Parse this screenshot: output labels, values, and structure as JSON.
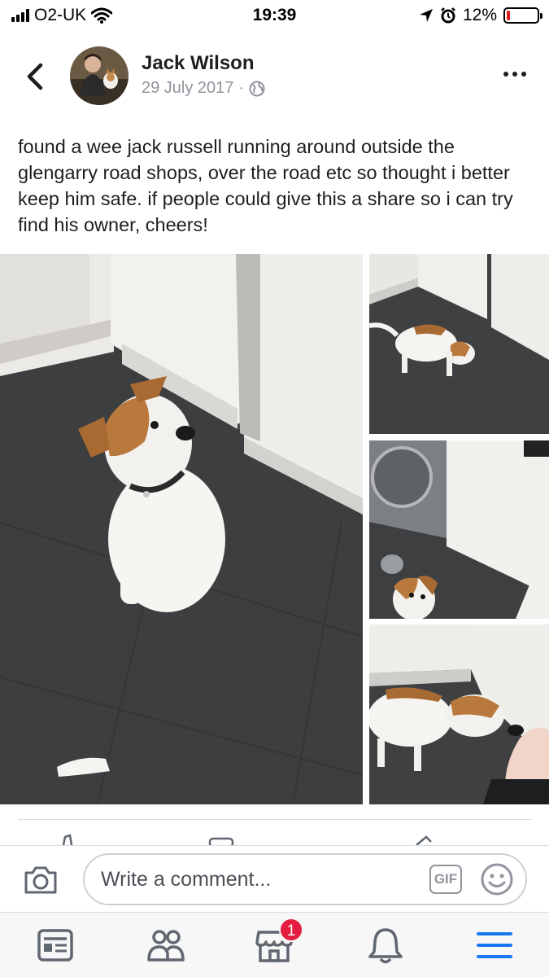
{
  "status_bar": {
    "carrier": "O2-UK",
    "time": "19:39",
    "battery": "12%",
    "battery_level": 0.12
  },
  "post": {
    "author": "Jack Wilson",
    "date": "29 July 2017",
    "separator": "·",
    "audience_icon": "globe-icon",
    "text": "found a wee jack russell running around outside the glengarry road shops, over the road etc so thought i better keep him safe. if people could give this a share so i can try find his owner, cheers!",
    "photo_count": 4
  },
  "comment_bar": {
    "placeholder": "Write a comment...",
    "gif_label": "GIF"
  },
  "bottom_nav": {
    "items": [
      "news-feed-icon",
      "friends-icon",
      "marketplace-icon",
      "notifications-icon",
      "menu-icon"
    ],
    "marketplace_badge": "1"
  },
  "colors": {
    "text": "#1c1e21",
    "meta_gray": "#90949c",
    "nav_active": "#1877f2",
    "badge_red": "#e41e3f",
    "battery_low": "#e0191a"
  }
}
